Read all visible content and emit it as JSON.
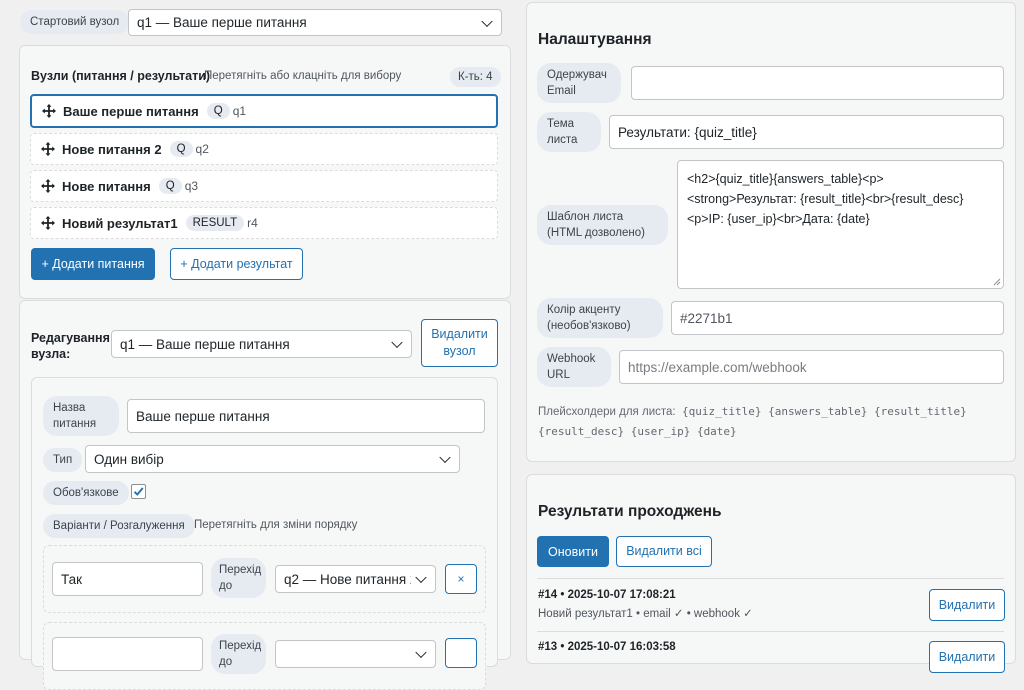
{
  "start_node": {
    "label": "Стартовий вузол",
    "value": "q1 — Ваше перше питання"
  },
  "nodes_panel": {
    "title": "Вузли (питання / результати)",
    "hint": "Перетягніть або клацніть для вибору",
    "count": "К-ть: 4",
    "nodes": [
      {
        "title": "Ваше перше питання",
        "badge": "Q",
        "id": "q1"
      },
      {
        "title": "Нове питання 2",
        "badge": "Q",
        "id": "q2"
      },
      {
        "title": "Нове питання",
        "badge": "Q",
        "id": "q3"
      },
      {
        "title": "Новий результат1",
        "badge": "RESULT",
        "id": "r4"
      }
    ],
    "add_question": "+ Додати питання",
    "add_result": "+ Додати результат"
  },
  "edit_node": {
    "label": "Редагування вузла:",
    "select_value": "q1 — Ваше перше питання",
    "delete_button": "Видалити вузол",
    "question_name_label": "Назва питання",
    "question_name_value": "Ваше перше питання",
    "type_label": "Тип",
    "type_value": "Один вибір",
    "required_label": "Обов'язкове",
    "options_label": "Варіанти / Розгалуження",
    "options_hint": "Перетягніть для зміни порядку",
    "options": [
      {
        "value": "Так",
        "goto_label": "Перехід до",
        "goto_value": "q2 — Нове питання 2",
        "remove": "×"
      },
      {
        "value": "",
        "goto_label": "Перехід до",
        "goto_value": "",
        "remove": ""
      }
    ]
  },
  "settings": {
    "title": "Налаштування",
    "email_label": "Одержувач Email",
    "email_value": "",
    "subject_label": "Тема листа",
    "subject_value": "Результати: {quiz_title}",
    "template_label": "Шаблон листа (HTML дозволено)",
    "template_lines": [
      "<h2>{quiz_title}{answers_table}<p>",
      "<strong>Результат: {result_title}<br>{result_desc}",
      "<p>IP: {user_ip}<br>Дата: {date}"
    ],
    "accent_label": "Колір акценту (необов'язково)",
    "accent_value": "#2271b1",
    "webhook_label": "Webhook URL",
    "webhook_placeholder": "https://example.com/webhook",
    "placeholders_label": "Плейсхолдери для листа:",
    "placeholders_line1": "{quiz_title} {answers_table} {result_title}",
    "placeholders_line2": "{result_desc} {user_ip} {date}"
  },
  "results": {
    "title": "Результати проходжень",
    "refresh": "Оновити",
    "delete_all": "Видалити всі",
    "entries": [
      {
        "header": "#14 • 2025-10-07 17:08:21",
        "detail": "Новий результат1 • email ✓ • webhook ✓",
        "delete": "Видалити"
      },
      {
        "header": "#13 • 2025-10-07 16:03:58",
        "detail": "",
        "delete": "Видалити"
      }
    ]
  },
  "colors": {
    "accent": "#2271b1",
    "background": "#f0f0f1"
  }
}
